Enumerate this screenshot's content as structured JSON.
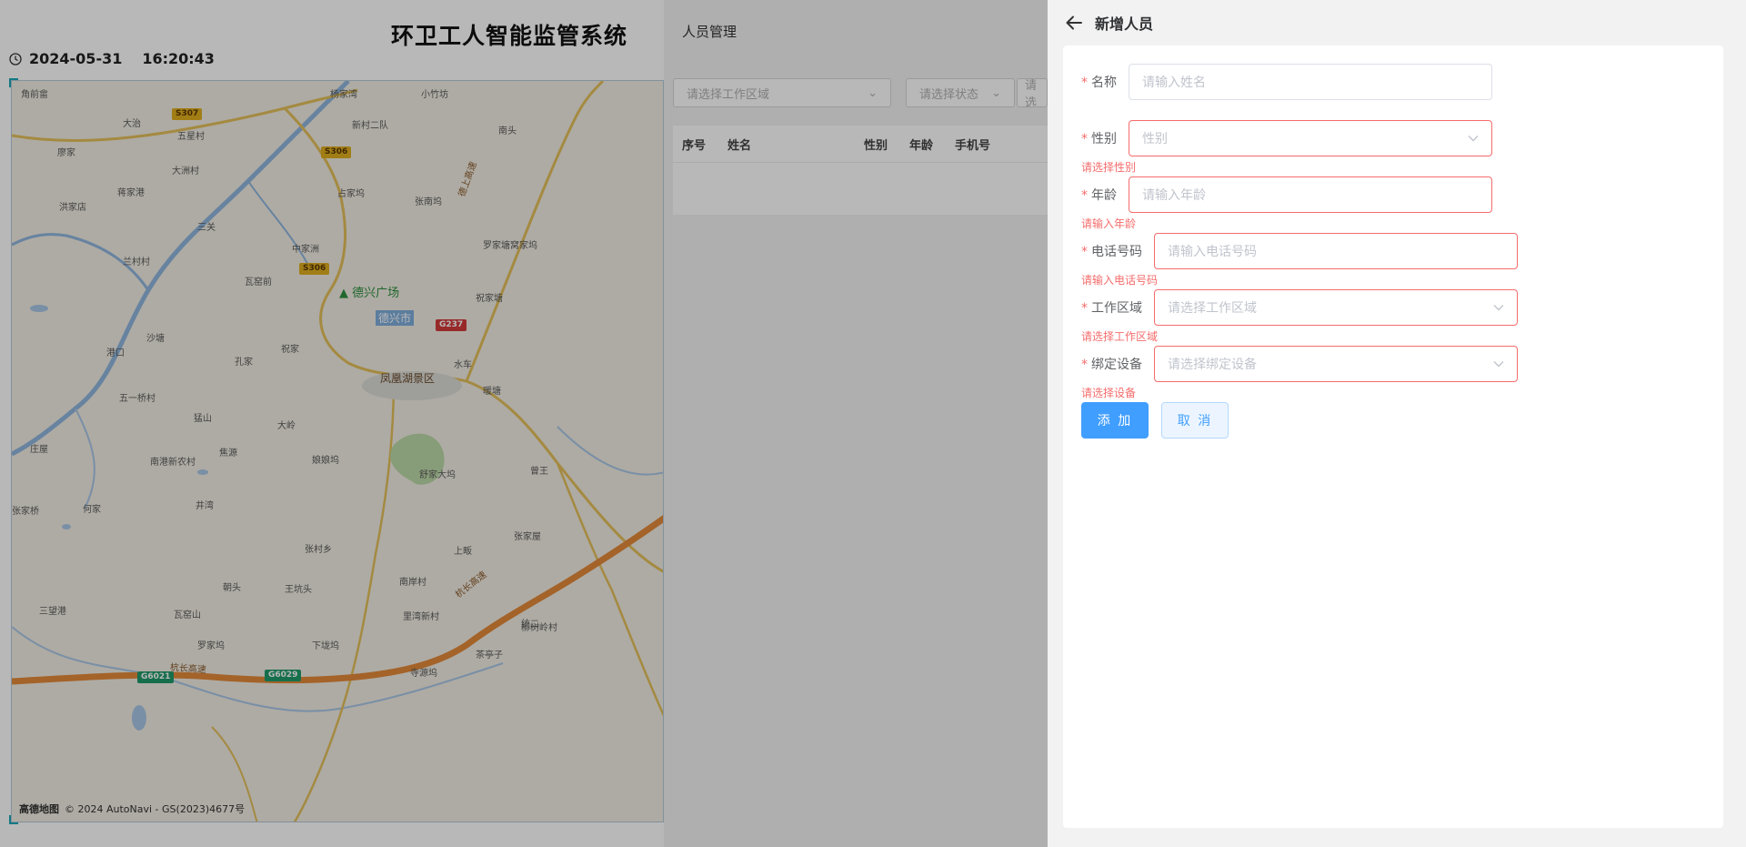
{
  "dashboard": {
    "title": "环卫工人智能监管系统",
    "date": "2024-05-31",
    "time": "16:20:43",
    "map": {
      "copyright": "© 2024 AutoNavi - GS(2023)4677号",
      "provider": "高德地图",
      "places": [
        "角前畲",
        "杨家湾",
        "小竹坊",
        "大治",
        "五星村",
        "新村二队",
        "南头",
        "廖家",
        "大洲村",
        "蒋家港",
        "占家坞",
        "洪家店",
        "张南坞",
        "三关",
        "罗家塘窝家坞",
        "兰村村",
        "中家洲",
        "祝家塘",
        "瓦窑前",
        "港口",
        "沙塘",
        "孔家",
        "祝家",
        "水车",
        "五一桥村",
        "暖塘",
        "猛山",
        "大岭",
        "庄屋",
        "南港新农村",
        "焦源",
        "娘娘坞",
        "舒家大坞",
        "曾王",
        "井湾",
        "何家",
        "张家桥",
        "张家屋",
        "张村乡",
        "上畈",
        "南岸村",
        "朝头",
        "王坑头",
        "瓦窑山",
        "三望港",
        "里湾新村",
        "罗家坞",
        "下垅坞",
        "寺源坞",
        "柳树岭村",
        "茶亭子",
        "统二"
      ],
      "road_signs": [
        "S307",
        "S306",
        "S306",
        "G237",
        "G6021",
        "G6029"
      ],
      "pois": [
        "德兴广场",
        "德兴市",
        "凤凰湖景区"
      ],
      "road_names": [
        "杭长高速",
        "杭长高速",
        "德上高速"
      ]
    }
  },
  "person_panel": {
    "title": "人员管理",
    "filters": [
      "请选择工作区域",
      "请选择状态",
      "请选"
    ],
    "columns": [
      "序号",
      "姓名",
      "性别",
      "年龄",
      "手机号"
    ]
  },
  "drawer": {
    "title": "新增人员",
    "fields": [
      {
        "label": "名称",
        "placeholder": "请输入姓名",
        "error": ""
      },
      {
        "label": "性别",
        "placeholder": "性别",
        "error": "请选择性别"
      },
      {
        "label": "年龄",
        "placeholder": "请输入年龄",
        "error": "请输入年龄"
      },
      {
        "label": "电话号码",
        "placeholder": "请输入电话号码",
        "error": "请输入电话号码"
      },
      {
        "label": "工作区域",
        "placeholder": "请选择工作区域",
        "error": "请选择工作区域"
      },
      {
        "label": "绑定设备",
        "placeholder": "请选择绑定设备",
        "error": "请选择设备"
      }
    ],
    "submit_label": "添 加",
    "cancel_label": "取 消"
  },
  "colors": {
    "primary": "#409eff",
    "error": "#f56c6c",
    "overlay": "rgba(0,0,0,0.28)"
  }
}
